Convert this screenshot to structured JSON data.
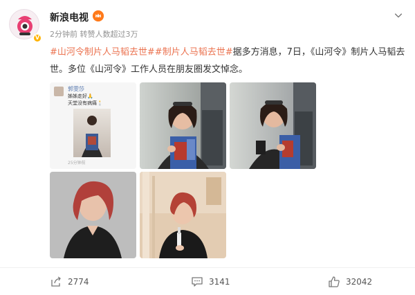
{
  "post": {
    "author": "新浪电视",
    "meta": "2分钟前 转赞人数超过3万",
    "topic1": "#山河令制片人马韬去世#",
    "topic2": "#制片人马韬去世#",
    "body_text": "据多方消息，7日，《山河令》制片人马韬去世。多位《山河令》工作人员在朋友圈发文悼念。"
  },
  "phone_screenshot": {
    "username": "郭雯莎",
    "line1": "姊姊走好🙏",
    "line2": "天堂没有病痛🕯️",
    "footer": "25分钟前"
  },
  "actions": {
    "share_count": "2774",
    "comment_count": "3141",
    "like_count": "32042"
  },
  "colors": {
    "topic": "#eb7350",
    "meta": "#939393"
  },
  "icons": [
    "more-chevron-icon",
    "share-icon",
    "comment-icon",
    "like-icon",
    "vip-crown-icon",
    "verified-badge-icon"
  ]
}
